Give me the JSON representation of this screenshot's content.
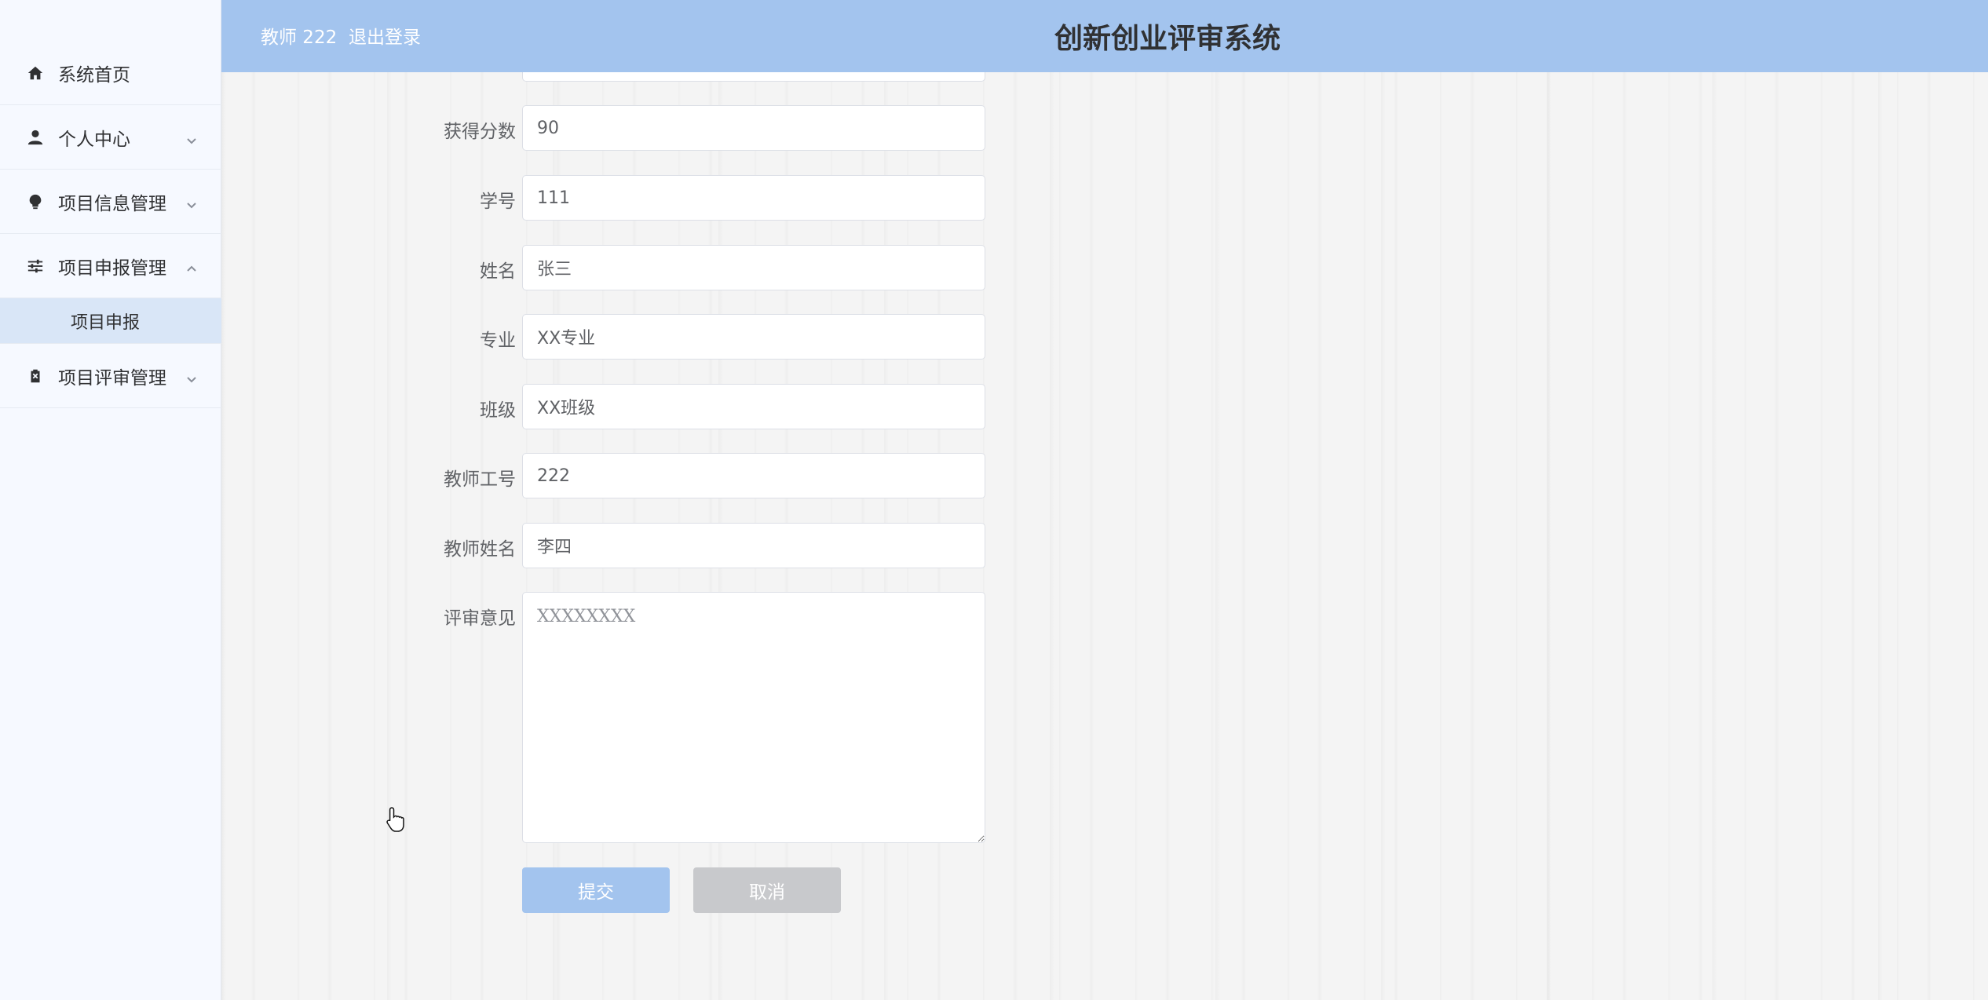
{
  "header": {
    "user_label": "教师 222",
    "logout_label": "退出登录",
    "title": "创新创业评审系统"
  },
  "sidebar": {
    "items": [
      {
        "label": "系统首页",
        "icon": "home-icon",
        "has_chevron": false
      },
      {
        "label": "个人中心",
        "icon": "user-icon",
        "has_chevron": true,
        "chevron": "down"
      },
      {
        "label": "项目信息管理",
        "icon": "lightbulb-icon",
        "has_chevron": true,
        "chevron": "down"
      },
      {
        "label": "项目申报管理",
        "icon": "sliders-icon",
        "has_chevron": true,
        "chevron": "up"
      },
      {
        "label": "项目评审管理",
        "icon": "clipboard-icon",
        "has_chevron": true,
        "chevron": "down"
      }
    ],
    "submenu": {
      "label": "项目申报"
    }
  },
  "form": {
    "fields": [
      {
        "label": "获得分数",
        "value": "90"
      },
      {
        "label": "学号",
        "value": "111"
      },
      {
        "label": "姓名",
        "value": "张三"
      },
      {
        "label": "专业",
        "value": "XX专业"
      },
      {
        "label": "班级",
        "value": "XX班级"
      },
      {
        "label": "教师工号",
        "value": "222"
      },
      {
        "label": "教师姓名",
        "value": "李四"
      }
    ],
    "comment": {
      "label": "评审意见",
      "value": "XXXXXXXX"
    },
    "submit_label": "提交",
    "cancel_label": "取消"
  },
  "colors": {
    "header_bg": "#a3c4ee",
    "sidebar_bg": "#f6f9ff",
    "submenu_active_bg": "#d9e6f7",
    "submit_bg": "#a3c4ee",
    "cancel_bg": "#c8c9cc"
  }
}
